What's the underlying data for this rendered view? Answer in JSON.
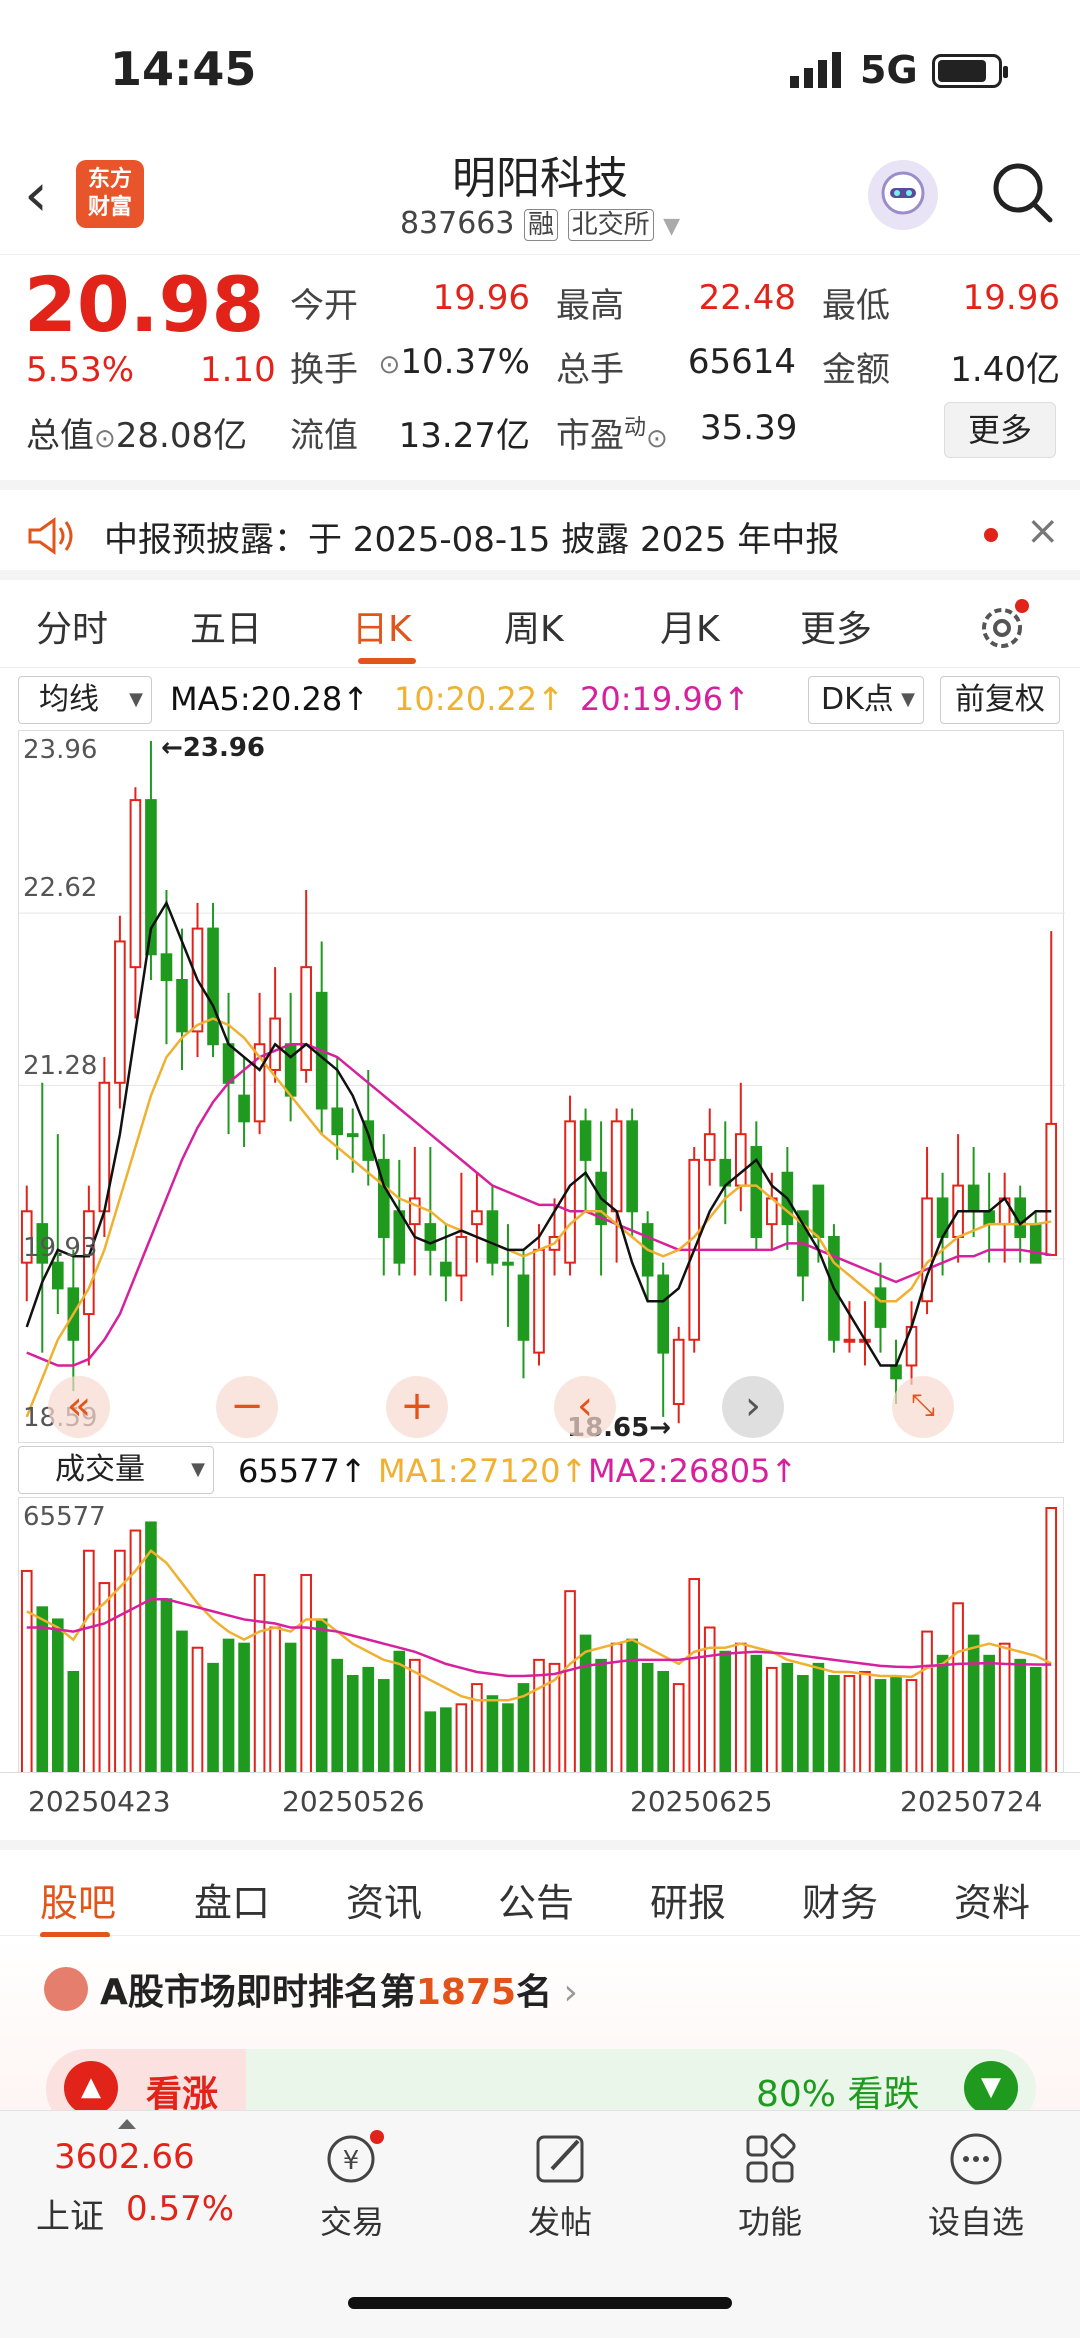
{
  "status": {
    "time": "14:45",
    "network": "5G"
  },
  "header": {
    "logo_line1": "东方",
    "logo_line2": "财富",
    "name": "明阳科技",
    "code": "837663",
    "tag1": "融",
    "tag2": "北交所"
  },
  "quote": {
    "price": "20.98",
    "pct": "5.53%",
    "change": "1.10",
    "total_label": "总值",
    "total_value": "28.08亿",
    "open_label": "今开",
    "open": "19.96",
    "high_label": "最高",
    "high": "22.48",
    "low_label": "最低",
    "low": "19.96",
    "turnover_label": "换手",
    "turnover": "10.37%",
    "vol_label": "总手",
    "vol": "65614",
    "amount_label": "金额",
    "amount": "1.40亿",
    "float_label": "流值",
    "float": "13.27亿",
    "pe_label": "市盈",
    "pe_sup": "动",
    "pe": "35.39",
    "more": "更多"
  },
  "notice": {
    "text": "中报预披露：于 2025-08-15 披露 2025 年中报"
  },
  "period_tabs": [
    "分时",
    "五日",
    "日K",
    "周K",
    "月K",
    "更多"
  ],
  "ma_row": {
    "select": "均线",
    "ma5": "MA5:20.28↑",
    "ma10": "10:20.22↑",
    "ma20": "20:19.96↑",
    "dk": "DK点",
    "fq": "前复权"
  },
  "colors": {
    "up": "#e2231a",
    "down": "#1f9a1f",
    "ma5": "#111111",
    "ma10": "#f0b030",
    "ma20": "#d6209e",
    "accent": "#e2541a"
  },
  "vol_row": {
    "select": "成交量",
    "vol": "65577↑",
    "ma1": "MA1:27120↑",
    "ma2": "MA2:26805↑"
  },
  "chart_data": {
    "type": "candlestick",
    "ylim": [
      18.59,
      23.96
    ],
    "y_ticks": [
      "23.96",
      "22.62",
      "21.28",
      "19.93",
      "18.59"
    ],
    "max_label": "←23.96",
    "min_label": "18.65→",
    "vol_max_label": "65577",
    "dates": [
      "20250423",
      "20250526",
      "20250625",
      "20250724"
    ],
    "candles": [
      [
        19.9,
        20.3,
        20.5,
        19.6,
        1
      ],
      [
        20.2,
        19.9,
        21.3,
        19.2,
        0
      ],
      [
        19.9,
        19.7,
        20.9,
        19.5,
        0
      ],
      [
        19.7,
        19.3,
        20.0,
        18.9,
        0
      ],
      [
        19.5,
        20.3,
        20.5,
        19.1,
        1
      ],
      [
        20.3,
        21.3,
        21.5,
        20.1,
        1
      ],
      [
        21.3,
        22.4,
        22.6,
        21.1,
        1
      ],
      [
        22.2,
        23.5,
        23.6,
        21.8,
        1
      ],
      [
        23.5,
        22.3,
        23.96,
        22.1,
        0
      ],
      [
        22.3,
        22.1,
        22.8,
        21.6,
        0
      ],
      [
        22.1,
        21.7,
        22.5,
        21.4,
        0
      ],
      [
        21.7,
        22.5,
        22.7,
        21.5,
        1
      ],
      [
        22.5,
        21.6,
        22.7,
        21.5,
        0
      ],
      [
        21.6,
        21.3,
        22.0,
        20.9,
        0
      ],
      [
        21.2,
        21.0,
        21.5,
        20.8,
        0
      ],
      [
        21.0,
        21.6,
        22.0,
        20.9,
        1
      ],
      [
        21.4,
        21.8,
        22.2,
        21.3,
        1
      ],
      [
        21.6,
        21.2,
        22.0,
        21.0,
        0
      ],
      [
        21.4,
        22.2,
        22.8,
        21.3,
        1
      ],
      [
        22.0,
        21.1,
        22.4,
        20.9,
        0
      ],
      [
        21.1,
        20.9,
        21.5,
        20.7,
        0
      ],
      [
        20.9,
        20.9,
        21.1,
        20.6,
        0
      ],
      [
        21.0,
        20.7,
        21.4,
        20.5,
        0
      ],
      [
        20.7,
        20.1,
        20.9,
        19.8,
        0
      ],
      [
        20.3,
        19.9,
        20.7,
        19.8,
        0
      ],
      [
        20.2,
        20.4,
        20.8,
        19.8,
        1
      ],
      [
        20.2,
        20.0,
        20.8,
        19.8,
        0
      ],
      [
        19.9,
        19.8,
        20.2,
        19.6,
        0
      ],
      [
        19.8,
        20.1,
        20.6,
        19.6,
        1
      ],
      [
        20.2,
        20.3,
        20.6,
        19.9,
        1
      ],
      [
        20.3,
        19.9,
        20.5,
        19.8,
        0
      ],
      [
        19.9,
        19.9,
        20.2,
        19.4,
        0
      ],
      [
        19.8,
        19.3,
        20.0,
        19.0,
        0
      ],
      [
        19.2,
        20.0,
        20.2,
        19.1,
        1
      ],
      [
        20.0,
        20.1,
        20.4,
        19.8,
        1
      ],
      [
        19.9,
        21.0,
        21.2,
        19.8,
        1
      ],
      [
        21.0,
        20.7,
        21.1,
        20.3,
        0
      ],
      [
        20.6,
        20.2,
        21.0,
        19.8,
        0
      ],
      [
        20.3,
        21.0,
        21.1,
        19.9,
        1
      ],
      [
        21.0,
        20.3,
        21.1,
        20.1,
        0
      ],
      [
        20.2,
        19.8,
        20.3,
        19.6,
        0
      ],
      [
        19.8,
        19.2,
        19.9,
        18.7,
        0
      ],
      [
        18.8,
        19.3,
        19.4,
        18.65,
        1
      ],
      [
        19.3,
        20.7,
        20.8,
        19.2,
        1
      ],
      [
        20.7,
        20.9,
        21.1,
        20.5,
        1
      ],
      [
        20.7,
        20.5,
        21.0,
        20.2,
        0
      ],
      [
        20.5,
        20.9,
        21.3,
        20.3,
        1
      ],
      [
        20.8,
        20.1,
        21.0,
        20.0,
        0
      ],
      [
        20.2,
        20.4,
        20.6,
        20.0,
        1
      ],
      [
        20.6,
        20.2,
        20.8,
        20.0,
        0
      ],
      [
        20.3,
        19.8,
        20.3,
        19.6,
        0
      ],
      [
        20.5,
        20.1,
        20.5,
        19.9,
        0
      ],
      [
        20.1,
        19.3,
        20.2,
        19.2,
        0
      ],
      [
        19.3,
        19.3,
        19.6,
        19.2,
        1
      ],
      [
        19.3,
        19.3,
        19.6,
        19.1,
        1
      ],
      [
        19.7,
        19.4,
        19.9,
        19.2,
        0
      ],
      [
        19.1,
        19.0,
        19.3,
        18.8,
        0
      ],
      [
        19.1,
        19.4,
        19.6,
        18.95,
        1
      ],
      [
        19.6,
        20.4,
        20.8,
        19.5,
        1
      ],
      [
        20.4,
        20.1,
        20.6,
        19.8,
        0
      ],
      [
        20.1,
        20.5,
        20.9,
        19.9,
        1
      ],
      [
        20.5,
        20.3,
        20.8,
        20.1,
        0
      ],
      [
        20.3,
        20.2,
        20.6,
        19.9,
        0
      ],
      [
        20.2,
        20.4,
        20.6,
        19.9,
        1
      ],
      [
        20.4,
        20.1,
        20.5,
        19.9,
        0
      ],
      [
        20.2,
        19.9,
        20.3,
        19.9,
        0
      ],
      [
        19.96,
        20.98,
        22.48,
        19.96,
        1
      ]
    ],
    "volumes": [
      50000,
      41000,
      38000,
      25000,
      55000,
      47000,
      55000,
      60000,
      62000,
      43000,
      35000,
      31000,
      27000,
      33000,
      32000,
      49000,
      36000,
      32000,
      49000,
      38000,
      28000,
      24000,
      26000,
      23000,
      30000,
      28000,
      15000,
      16000,
      17000,
      22000,
      19000,
      17000,
      22000,
      28000,
      27000,
      45000,
      34000,
      28000,
      32000,
      33000,
      27000,
      25000,
      22000,
      48000,
      36000,
      30000,
      32000,
      29000,
      26000,
      27000,
      24000,
      27000,
      24000,
      24000,
      25000,
      23000,
      24000,
      23000,
      35000,
      29000,
      42000,
      34000,
      29000,
      32000,
      28000,
      26000,
      65577
    ],
    "ma5": [
      19.4,
      19.75,
      20.0,
      19.95,
      19.95,
      20.3,
      20.9,
      21.7,
      22.5,
      22.7,
      22.4,
      22.1,
      21.9,
      21.6,
      21.5,
      21.4,
      21.6,
      21.5,
      21.6,
      21.5,
      21.4,
      21.2,
      20.9,
      20.5,
      20.3,
      20.1,
      20.05,
      20.1,
      20.15,
      20.1,
      20.05,
      20.0,
      20.0,
      20.1,
      20.3,
      20.5,
      20.6,
      20.4,
      20.3,
      19.9,
      19.6,
      19.6,
      19.7,
      20.0,
      20.3,
      20.5,
      20.6,
      20.7,
      20.5,
      20.4,
      20.2,
      20.0,
      19.7,
      19.5,
      19.3,
      19.1,
      19.1,
      19.4,
      19.8,
      20.1,
      20.3,
      20.3,
      20.3,
      20.4,
      20.2,
      20.3,
      20.3
    ],
    "ma10": [
      18.7,
      19.0,
      19.3,
      19.5,
      19.7,
      20.0,
      20.4,
      20.8,
      21.2,
      21.5,
      21.65,
      21.75,
      21.8,
      21.75,
      21.65,
      21.5,
      21.35,
      21.2,
      21.05,
      20.9,
      20.8,
      20.7,
      20.6,
      20.5,
      20.4,
      20.35,
      20.3,
      20.2,
      20.15,
      20.1,
      20.05,
      20.0,
      19.95,
      20.0,
      20.05,
      20.2,
      20.3,
      20.3,
      20.2,
      20.1,
      20.0,
      19.95,
      20.0,
      20.1,
      20.25,
      20.4,
      20.5,
      20.5,
      20.4,
      20.3,
      20.2,
      20.1,
      19.9,
      19.8,
      19.7,
      19.6,
      19.6,
      19.7,
      19.9,
      20.0,
      20.1,
      20.15,
      20.2,
      20.2,
      20.2,
      20.2,
      20.22
    ],
    "ma20": [
      19.2,
      19.15,
      19.1,
      19.1,
      19.15,
      19.3,
      19.5,
      19.8,
      20.1,
      20.4,
      20.7,
      20.95,
      21.15,
      21.3,
      21.4,
      21.5,
      21.55,
      21.6,
      21.6,
      21.55,
      21.5,
      21.4,
      21.3,
      21.2,
      21.1,
      21.0,
      20.9,
      20.8,
      20.7,
      20.6,
      20.5,
      20.45,
      20.4,
      20.35,
      20.35,
      20.3,
      20.3,
      20.25,
      20.2,
      20.15,
      20.1,
      20.05,
      20.0,
      20.0,
      20.0,
      20.0,
      20.0,
      20.0,
      20.0,
      20.05,
      20.05,
      20.0,
      19.95,
      19.9,
      19.85,
      19.8,
      19.75,
      19.8,
      19.85,
      19.9,
      19.95,
      19.95,
      20.0,
      20.0,
      20.0,
      19.98,
      19.96
    ],
    "vol_ma1": [
      40000,
      38000,
      36000,
      33000,
      39000,
      42000,
      46000,
      50000,
      55000,
      52000,
      47000,
      42000,
      38000,
      35000,
      33000,
      35000,
      36000,
      35000,
      38000,
      38000,
      35000,
      32000,
      30000,
      28000,
      27000,
      25000,
      23000,
      21000,
      19000,
      18000,
      18000,
      18000,
      19000,
      21000,
      23000,
      27000,
      30000,
      31000,
      32000,
      33000,
      31000,
      29000,
      27000,
      30000,
      31000,
      31000,
      32000,
      31000,
      30000,
      28000,
      27000,
      26000,
      25000,
      25000,
      24500,
      24000,
      24000,
      23800,
      26000,
      27000,
      30000,
      31000,
      32000,
      31000,
      30000,
      29000,
      27120
    ],
    "vol_ma2": [
      36000,
      36000,
      35500,
      35000,
      36000,
      37000,
      39000,
      41000,
      43000,
      43000,
      42000,
      41000,
      40000,
      39000,
      38000,
      37500,
      37000,
      36000,
      36000,
      35500,
      35000,
      34000,
      33000,
      32000,
      31000,
      30000,
      28500,
      27000,
      26000,
      25000,
      24500,
      24000,
      24000,
      24200,
      24500,
      25500,
      26500,
      27000,
      27500,
      28000,
      28000,
      28000,
      28000,
      28500,
      29000,
      29500,
      29800,
      30000,
      29800,
      29500,
      29000,
      28500,
      28000,
      27500,
      27000,
      26500,
      26300,
      26200,
      26500,
      26700,
      27000,
      27100,
      27200,
      27000,
      26900,
      26850,
      26805
    ]
  },
  "content_tabs": [
    "股吧",
    "盘口",
    "资讯",
    "公告",
    "研报",
    "财务",
    "资料"
  ],
  "rank": {
    "prefix": "A股市场即时排名第",
    "num": "1875",
    "suffix": "名",
    "up": "看涨",
    "down": "80% 看跌"
  },
  "bottom_nav": {
    "index_value": "3602.66",
    "index_name": "上证",
    "index_pct": "0.57%",
    "items": [
      "交易",
      "发帖",
      "功能",
      "设自选"
    ]
  }
}
